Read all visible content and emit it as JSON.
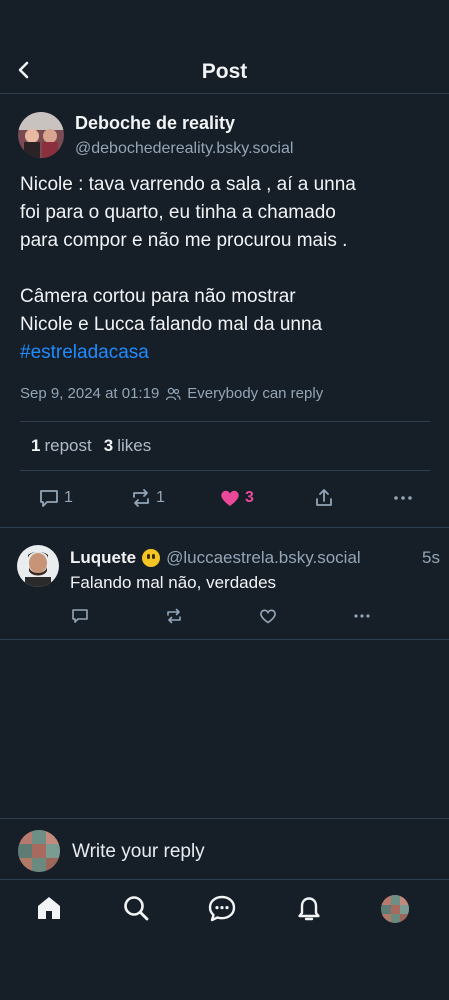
{
  "header": {
    "title": "Post"
  },
  "post": {
    "author_name": "Deboche de reality",
    "author_handle": "@debochedereality.bsky.social",
    "text_line1": "Nicole : tava varrendo a sala , aí a unna",
    "text_line2": "foi para o quarto, eu tinha a chamado",
    "text_line3": "para compor e não me procurou mais .",
    "text_line4": "Câmera cortou para não mostrar",
    "text_line5": "Nicole e Lucca falando mal da unna",
    "hashtag": "#estreladacasa",
    "timestamp": "Sep 9, 2024 at 01:19",
    "reply_setting": "Everybody can reply",
    "repost_count": "1",
    "repost_label": "repost",
    "like_count": "3",
    "like_label": "likes",
    "actions": {
      "reply_count": "1",
      "repost_count": "1",
      "like_count": "3"
    }
  },
  "reply": {
    "name": "Luquete",
    "handle": "@luccaestrela.bsky.social",
    "time": "5s",
    "text": "Falando mal não, verdades"
  },
  "composer": {
    "placeholder": "Write your reply"
  },
  "colors": {
    "background": "#161e27",
    "accent": "#208bfe",
    "like": "#ec4899",
    "muted": "#93a5b7"
  },
  "icons": [
    "back-icon",
    "people-icon",
    "comment-icon",
    "repost-icon",
    "heart-icon",
    "share-icon",
    "more-icon",
    "home-icon",
    "search-icon",
    "chat-icon",
    "bell-icon"
  ]
}
